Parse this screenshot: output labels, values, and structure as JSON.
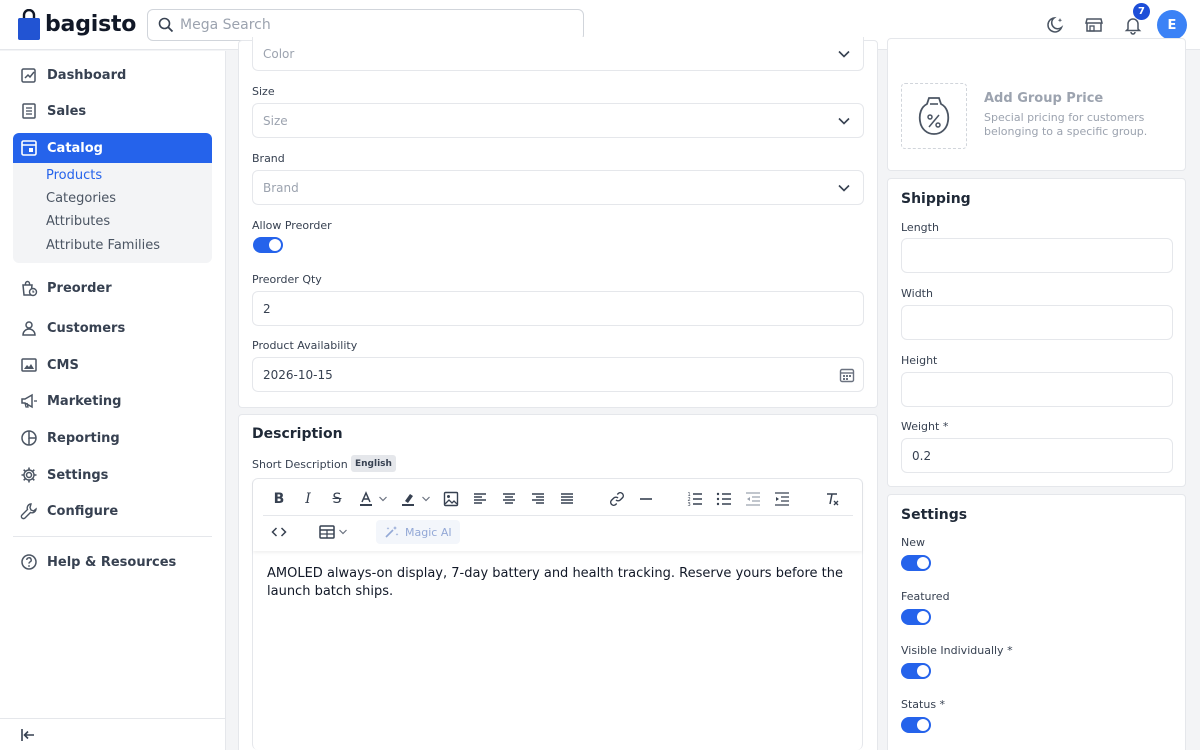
{
  "header": {
    "logo_text": "bagisto",
    "search_placeholder": "Mega Search",
    "notification_count": "7",
    "avatar_initial": "E"
  },
  "sidebar": {
    "items": [
      {
        "label": "Dashboard",
        "icon": "dashboard-icon"
      },
      {
        "label": "Sales",
        "icon": "sales-icon"
      },
      {
        "label": "Catalog",
        "icon": "catalog-icon"
      },
      {
        "label": "Preorder",
        "icon": "preorder-icon"
      },
      {
        "label": "Customers",
        "icon": "customers-icon"
      },
      {
        "label": "CMS",
        "icon": "cms-icon"
      },
      {
        "label": "Marketing",
        "icon": "marketing-icon"
      },
      {
        "label": "Reporting",
        "icon": "reporting-icon"
      },
      {
        "label": "Settings",
        "icon": "settings-icon"
      },
      {
        "label": "Configure",
        "icon": "configure-icon"
      },
      {
        "label": "Help & Resources",
        "icon": "help-icon"
      }
    ],
    "catalog_sub": [
      "Products",
      "Categories",
      "Attributes",
      "Attribute Families"
    ],
    "active_item": "Catalog",
    "active_sub": "Products"
  },
  "form": {
    "color_placeholder": "Color",
    "size_label": "Size",
    "size_placeholder": "Size",
    "brand_label": "Brand",
    "brand_placeholder": "Brand",
    "allow_preorder_label": "Allow Preorder",
    "allow_preorder_on": true,
    "preorder_qty_label": "Preorder Qty",
    "preorder_qty_value": "2",
    "availability_label": "Product Availability",
    "availability_value": "2026-10-15"
  },
  "description": {
    "title": "Description",
    "short_label": "Short Description *",
    "lang_badge": "English",
    "magic_ai_label": "Magic AI",
    "content": "AMOLED always-on display, 7-day battery and health tracking. Reserve yours before the launch batch ships."
  },
  "group_price": {
    "title": "Add Group Price",
    "description": "Special pricing for customers belonging to a specific group."
  },
  "shipping": {
    "title": "Shipping",
    "length_label": "Length",
    "length_value": "",
    "width_label": "Width",
    "width_value": "",
    "height_label": "Height",
    "height_value": "",
    "weight_label": "Weight *",
    "weight_value": "0.2"
  },
  "settings": {
    "title": "Settings",
    "toggles": [
      {
        "label": "New",
        "on": true
      },
      {
        "label": "Featured",
        "on": true
      },
      {
        "label": "Visible Individually *",
        "on": true
      },
      {
        "label": "Status *",
        "on": true
      }
    ]
  },
  "colors": {
    "accent": "#2563eb",
    "badge": "#1d4ed8"
  }
}
